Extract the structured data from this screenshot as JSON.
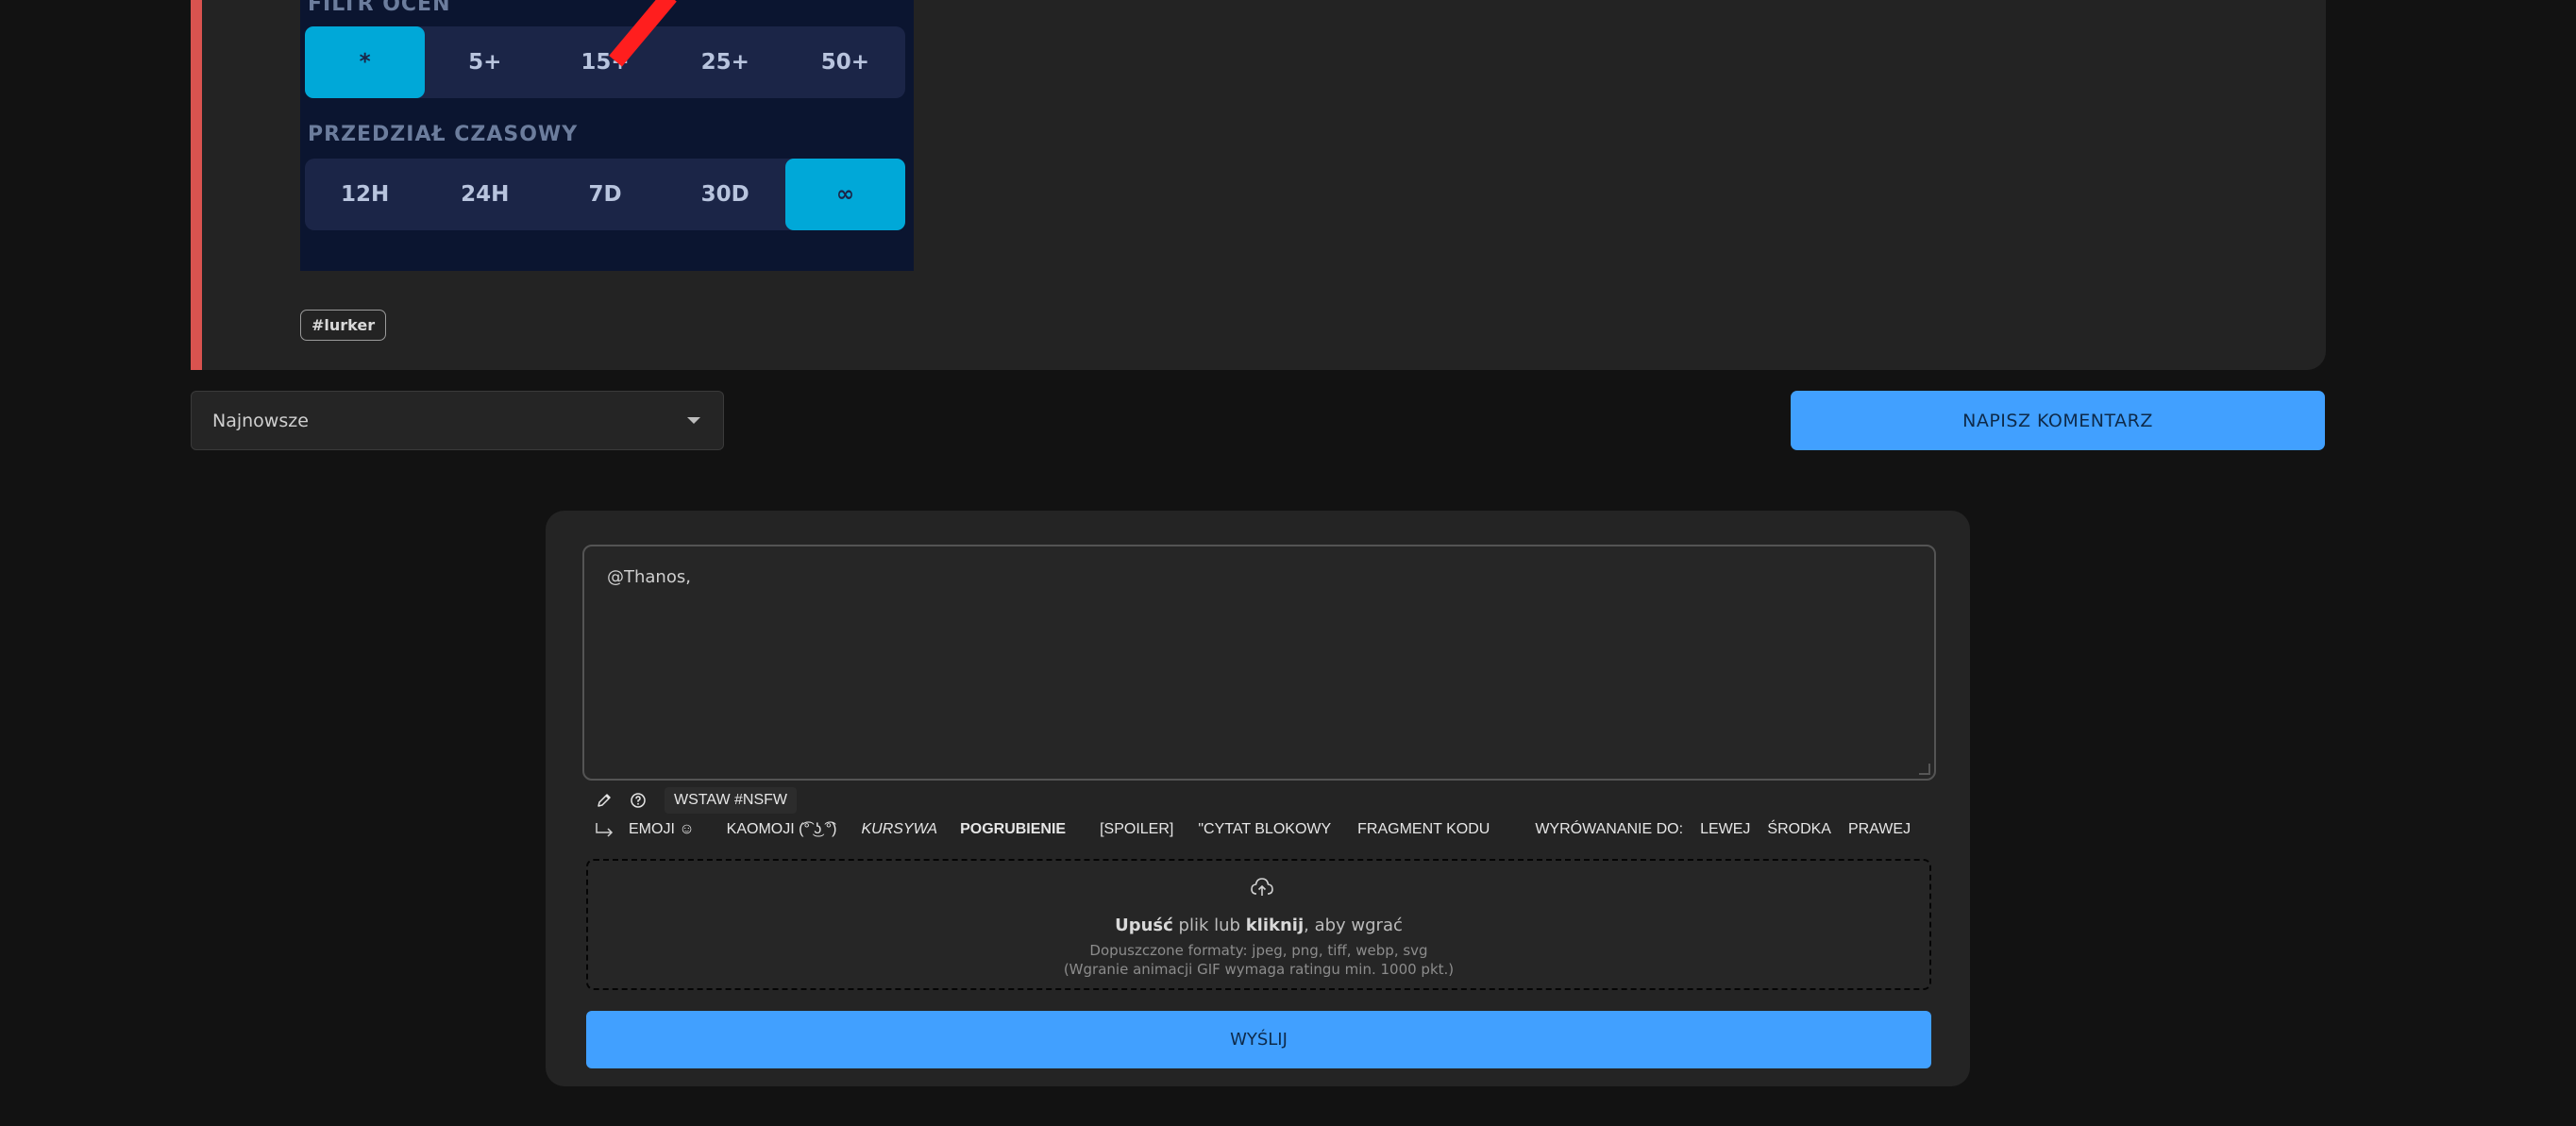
{
  "post": {
    "embed": {
      "rating_filter_label": "FILTR OCEN",
      "rating_filter_options": [
        "*",
        "5+",
        "15+",
        "25+",
        "50+"
      ],
      "rating_filter_active": "*",
      "time_range_label": "PRZEDZIAŁ CZASOWY",
      "time_range_options": [
        "12H",
        "24H",
        "7D",
        "30D",
        "∞"
      ],
      "time_range_active": "∞"
    },
    "tag": "#lurker"
  },
  "sort": {
    "selected": "Najnowsze"
  },
  "write_comment_label": "NAPISZ KOMENTARZ",
  "comment_form": {
    "textarea_value": "@Thanos,",
    "toolbar": {
      "nsfw_label": "WSTAW #NSFW",
      "emoji_label": "EMOJI ☺",
      "kaomoji_label": "KAOMOJI (͡° ͜ʖ ͡°)",
      "italic_label": "KURSYWA",
      "bold_label": "POGRUBIENIE",
      "spoiler_label": "[SPOILER]",
      "quote_label": "\"CYTAT BLOKOWY",
      "code_label": "FRAGMENT KODU",
      "align_label": "WYRÓWANANIE DO:",
      "align_left": "LEWEJ",
      "align_center": "ŚRODKA",
      "align_right": "PRAWEJ"
    },
    "dropzone": {
      "drop_bold": "Upuść",
      "middle": "plik lub",
      "click_bold": "kliknij",
      "end": ", aby wgrać",
      "formats": "Dopuszczone formaty: jpeg, png, tiff, webp, svg",
      "gif_note": "(Wgranie animacji GIF wymaga ratingu min. 1000 pkt.)"
    },
    "send_label": "WYŚLIJ"
  },
  "colors": {
    "accent": "#41a0ff",
    "post_accent": "#d9534f",
    "embed_active": "#00a8d8"
  }
}
